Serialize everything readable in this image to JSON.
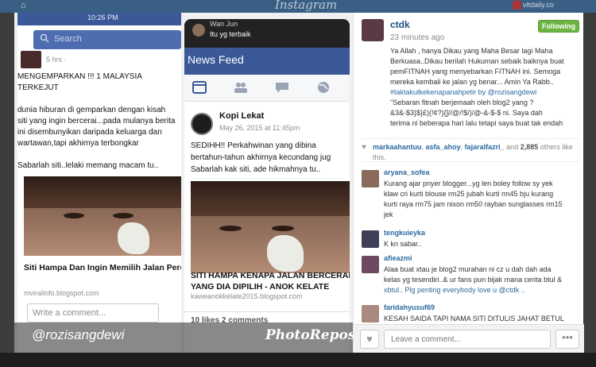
{
  "background": {
    "brand": "Instagram",
    "username": "vitdaily.co",
    "home_glyph": "⌂"
  },
  "photo": {
    "phone1": {
      "status_time": "10:26 PM",
      "search_placeholder": "Search",
      "post_time": "5 hrs ·",
      "text_lines": [
        "MENGEMPARKAN !!! 1 MALAYSIA",
        "TERKEJUT",
        "",
        "dunia hiburan di gemparkan dengan kisah",
        "siti yang ingin bercerai...pada mulanya berita",
        "ini disembunyikan daripada keluarga dan",
        "wartawan,tapi akhirnya terbongkar",
        "",
        "Sabarlah siti..lelaki memang macam tu.."
      ],
      "caption": "Siti Hampa Dan Ingin Memilih Jalan Perceraian Demi Kebahagian Bersa...",
      "source": "mviralinfo.blogspot.com",
      "comment_placeholder": "Write a comment..."
    },
    "phone2": {
      "notif_name": "Wan Jun",
      "notif_msg": "Itu yg terbaik",
      "nav_title": "News Feed",
      "author": "Kopi Lekat",
      "date": "May 26, 2015 at 11:45pm",
      "text_lines": [
        "SEDIHH!! Perkahwinan yang dibina",
        "bertahun-tahun akhirnya kecundang jug",
        "Sabarlah kak siti, ade hikmahnya tu.."
      ],
      "caption_lines": [
        "SITI HAMPA KENAPA JALAN BERCERAI",
        "YANG DIA DIPILIH - ANOK KELATE"
      ],
      "source": "kaweanokkelate2015.blogspot.com",
      "stats": "10 likes   2 comments"
    },
    "watermark_handle": "@rozisangdewi",
    "watermark_app": "PhotoRepost"
  },
  "panel": {
    "owner": "ctdk",
    "time": "23 minutes ago",
    "follow_label": "Following",
    "caption_lines": [
      "Ya Allah , hanya Dikau yang Maha Besar lagi Maha",
      "Berkuasa..Dikau berilah Hukuman sebaik baiknya buat",
      "pemFITNAH yang menyebarkan FITNAH ini. Semoga",
      "mereka kembali ke jalan yg benar... Amin Ya Rabb..",
      "#taktakutkekenapanahpetir by @rozisangdewi",
      "\"Sebaran fitnah berjemaah oleh blog2 yang ?",
      "&3&-$3}$}£)(!¢?}{]//@/!$/)/@-&-$-$ ni. Saya dah",
      "terima ni beberapa hari lalu tetapi saya buat tak endah"
    ],
    "likes": {
      "users": [
        "markaahantuu",
        "asfa_ahoy",
        "fajaralfazri_"
      ],
      "and": "and",
      "count": "2,885",
      "suffix": "others like this."
    },
    "comments": [
      {
        "user": "aryana_sofea",
        "lines": [
          "Kurang ajar pnyer blogger...yg len boley follow sy yek",
          "klaw cri kurti blouse rm25 jubah kurti rm45 bju kurang",
          "kurti raya rm75 jam nixon rm50 rayban sunglasses rm15",
          "jek"
        ]
      },
      {
        "user": "tengkuieyka",
        "lines": [
          "K kn sabar.."
        ]
      },
      {
        "user": "afieazmi",
        "lines": [
          "Alaa buat xtau je blog2 murahan ni cz u dah dah ada",
          "kelas yg tesendiri..& ur fans pun bijak mana cerita btul &",
          "xbtul.. Plg penting everybody love u @ctdk .."
        ]
      },
      {
        "user": "faridahyusuf69",
        "lines": [
          "KESAH SAIDA TAPI NAMA SITI DITULIS JAHAT BETUL"
        ]
      }
    ],
    "comment_placeholder": "Leave a comment...",
    "more_glyph": "•••",
    "heart_glyph": "♥"
  }
}
